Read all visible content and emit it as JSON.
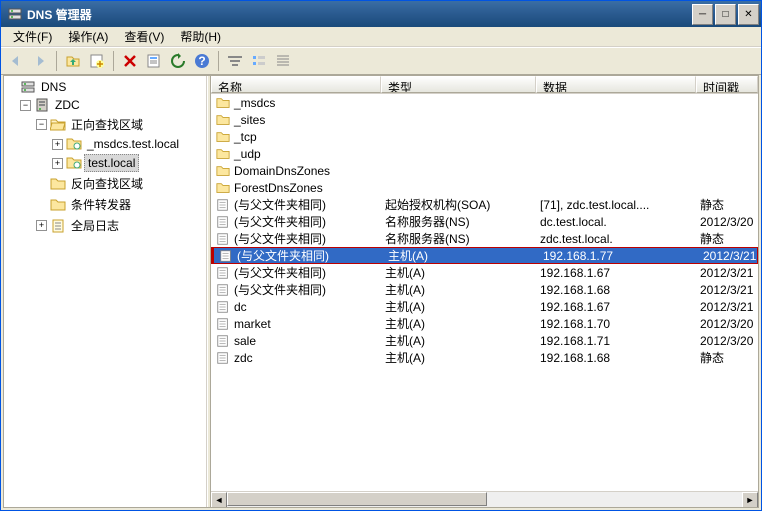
{
  "window": {
    "title": "DNS 管理器"
  },
  "menu": {
    "file": "文件(F)",
    "action": "操作(A)",
    "view": "查看(V)",
    "help": "帮助(H)"
  },
  "tree": {
    "root": "DNS",
    "server": "ZDC",
    "fwd": "正向查找区域",
    "zone_msdcs": "_msdcs.test.local",
    "zone_test": "test.local",
    "rev": "反向查找区域",
    "cond": "条件转发器",
    "global": "全局日志"
  },
  "columns": {
    "name": "名称",
    "type": "类型",
    "data": "数据",
    "ts": "时间戳"
  },
  "rows": [
    {
      "icon": "folder",
      "name": "_msdcs",
      "type": "",
      "data": "",
      "ts": "",
      "sel": false
    },
    {
      "icon": "folder",
      "name": "_sites",
      "type": "",
      "data": "",
      "ts": "",
      "sel": false
    },
    {
      "icon": "folder",
      "name": "_tcp",
      "type": "",
      "data": "",
      "ts": "",
      "sel": false
    },
    {
      "icon": "folder",
      "name": "_udp",
      "type": "",
      "data": "",
      "ts": "",
      "sel": false
    },
    {
      "icon": "folder",
      "name": "DomainDnsZones",
      "type": "",
      "data": "",
      "ts": "",
      "sel": false
    },
    {
      "icon": "folder",
      "name": "ForestDnsZones",
      "type": "",
      "data": "",
      "ts": "",
      "sel": false
    },
    {
      "icon": "record",
      "name": "(与父文件夹相同)",
      "type": "起始授权机构(SOA)",
      "data": "[71], zdc.test.local....",
      "ts": "静态",
      "sel": false
    },
    {
      "icon": "record",
      "name": "(与父文件夹相同)",
      "type": "名称服务器(NS)",
      "data": "dc.test.local.",
      "ts": "2012/3/20",
      "sel": false
    },
    {
      "icon": "record",
      "name": "(与父文件夹相同)",
      "type": "名称服务器(NS)",
      "data": "zdc.test.local.",
      "ts": "静态",
      "sel": false
    },
    {
      "icon": "record",
      "name": "(与父文件夹相同)",
      "type": "主机(A)",
      "data": "192.168.1.77",
      "ts": "2012/3/21",
      "sel": true
    },
    {
      "icon": "record",
      "name": "(与父文件夹相同)",
      "type": "主机(A)",
      "data": "192.168.1.67",
      "ts": "2012/3/21",
      "sel": false
    },
    {
      "icon": "record",
      "name": "(与父文件夹相同)",
      "type": "主机(A)",
      "data": "192.168.1.68",
      "ts": "2012/3/21",
      "sel": false
    },
    {
      "icon": "record",
      "name": "dc",
      "type": "主机(A)",
      "data": "192.168.1.67",
      "ts": "2012/3/21",
      "sel": false
    },
    {
      "icon": "record",
      "name": "market",
      "type": "主机(A)",
      "data": "192.168.1.70",
      "ts": "2012/3/20",
      "sel": false
    },
    {
      "icon": "record",
      "name": "sale",
      "type": "主机(A)",
      "data": "192.168.1.71",
      "ts": "2012/3/20",
      "sel": false
    },
    {
      "icon": "record",
      "name": "zdc",
      "type": "主机(A)",
      "data": "192.168.1.68",
      "ts": "静态",
      "sel": false
    }
  ]
}
